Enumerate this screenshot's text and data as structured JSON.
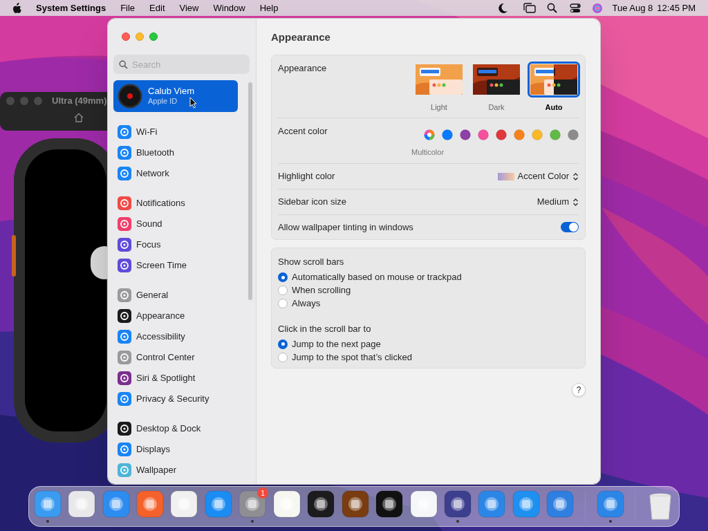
{
  "menu_bar": {
    "app_name": "System Settings",
    "menus": [
      "File",
      "Edit",
      "View",
      "Window",
      "Help"
    ],
    "date": "Tue Aug 8",
    "time": "12:45 PM"
  },
  "background_window": {
    "title": "Ultra (49mm)"
  },
  "sidebar": {
    "search": {
      "placeholder": "Search"
    },
    "account": {
      "name": "Calub Viem",
      "subtitle": "Apple ID",
      "selected": true
    },
    "groups": [
      {
        "items": [
          {
            "label": "Wi-Fi",
            "color": "#1a84f5",
            "selected": false
          },
          {
            "label": "Bluetooth",
            "color": "#1a84f5",
            "selected": false
          },
          {
            "label": "Network",
            "color": "#1a84f5",
            "selected": false
          }
        ]
      },
      {
        "items": [
          {
            "label": "Notifications",
            "color": "#ef4a45",
            "selected": false
          },
          {
            "label": "Sound",
            "color": "#ef3f6a",
            "selected": false
          },
          {
            "label": "Focus",
            "color": "#5e4bd8",
            "selected": false
          },
          {
            "label": "Screen Time",
            "color": "#5e4bd8",
            "selected": false
          }
        ]
      },
      {
        "items": [
          {
            "label": "General",
            "color": "#9a9a9e",
            "selected": false
          },
          {
            "label": "Appearance",
            "color": "#1b1b1b",
            "selected": false
          },
          {
            "label": "Accessibility",
            "color": "#1a84f5",
            "selected": false
          },
          {
            "label": "Control Center",
            "color": "#9a9a9e",
            "selected": false
          },
          {
            "label": "Siri & Spotlight",
            "color": "#7a2f8e",
            "selected": false
          },
          {
            "label": "Privacy & Security",
            "color": "#1a84f5",
            "selected": false
          }
        ]
      },
      {
        "items": [
          {
            "label": "Desktop & Dock",
            "color": "#1b1b1b",
            "selected": false
          },
          {
            "label": "Displays",
            "color": "#1a84f5",
            "selected": false
          },
          {
            "label": "Wallpaper",
            "color": "#4cb5d8",
            "selected": false
          }
        ]
      }
    ]
  },
  "content": {
    "title": "Appearance",
    "appearance": {
      "label": "Appearance",
      "options": [
        {
          "label": "Light",
          "kind": "light",
          "selected": false
        },
        {
          "label": "Dark",
          "kind": "dark",
          "selected": false
        },
        {
          "label": "Auto",
          "kind": "auto",
          "selected": true
        }
      ]
    },
    "accent": {
      "label": "Accent color",
      "caption": "Multicolor",
      "swatches": [
        {
          "kind": "multicolor",
          "selected": true
        },
        {
          "kind": "solid",
          "color": "#0a7aff",
          "selected": false
        },
        {
          "kind": "solid",
          "color": "#8e3fa8",
          "selected": false
        },
        {
          "kind": "solid",
          "color": "#f74f9e",
          "selected": false
        },
        {
          "kind": "solid",
          "color": "#e0383e",
          "selected": false
        },
        {
          "kind": "solid",
          "color": "#f7821b",
          "selected": false
        },
        {
          "kind": "solid",
          "color": "#fcb827",
          "selected": false
        },
        {
          "kind": "solid",
          "color": "#62ba46",
          "selected": false
        },
        {
          "kind": "solid",
          "color": "#8c8c8c",
          "selected": false
        }
      ]
    },
    "highlight": {
      "label": "Highlight color",
      "value": "Accent Color"
    },
    "icon_size": {
      "label": "Sidebar icon size",
      "value": "Medium"
    },
    "tinting": {
      "label": "Allow wallpaper tinting in windows",
      "on": true
    },
    "scroll_bars": {
      "label": "Show scroll bars",
      "options": [
        {
          "label": "Automatically based on mouse or trackpad",
          "selected": true
        },
        {
          "label": "When scrolling",
          "selected": false
        },
        {
          "label": "Always",
          "selected": false
        }
      ]
    },
    "click_scroll": {
      "label": "Click in the scroll bar to",
      "options": [
        {
          "label": "Jump to the next page",
          "selected": true
        },
        {
          "label": "Jump to the spot that’s clicked",
          "selected": false
        }
      ]
    },
    "help": "?"
  },
  "dock": {
    "items": [
      {
        "kind": "app",
        "color": "#3a9bf0",
        "running": true
      },
      {
        "kind": "app",
        "color": "#e8e8ea",
        "running": false
      },
      {
        "kind": "app",
        "color": "#2d8cf0",
        "running": false
      },
      {
        "kind": "app",
        "color": "#f5612b",
        "running": false
      },
      {
        "kind": "app",
        "color": "#f0f0f0",
        "running": false
      },
      {
        "kind": "app",
        "color": "#1b8cf2",
        "running": false
      },
      {
        "kind": "app",
        "color": "#8e8e93",
        "running": true,
        "badge": "1"
      },
      {
        "kind": "app",
        "color": "#f7f7f2",
        "running": false
      },
      {
        "kind": "app",
        "color": "#1c1c1e",
        "running": false
      },
      {
        "kind": "app",
        "color": "#7a3d12",
        "running": false
      },
      {
        "kind": "app",
        "color": "#111111",
        "running": false
      },
      {
        "kind": "app",
        "color": "#f4f6f8",
        "running": false
      },
      {
        "kind": "app",
        "color": "#3c3f8e",
        "running": true
      },
      {
        "kind": "app",
        "color": "#2b86e6",
        "running": false
      },
      {
        "kind": "app",
        "color": "#1e90f0",
        "running": false
      },
      {
        "kind": "app",
        "color": "#2e7fe0",
        "running": false
      },
      {
        "kind": "separator"
      },
      {
        "kind": "app",
        "color": "#2b86e6",
        "running": true
      },
      {
        "kind": "separator"
      },
      {
        "kind": "trash"
      }
    ]
  }
}
